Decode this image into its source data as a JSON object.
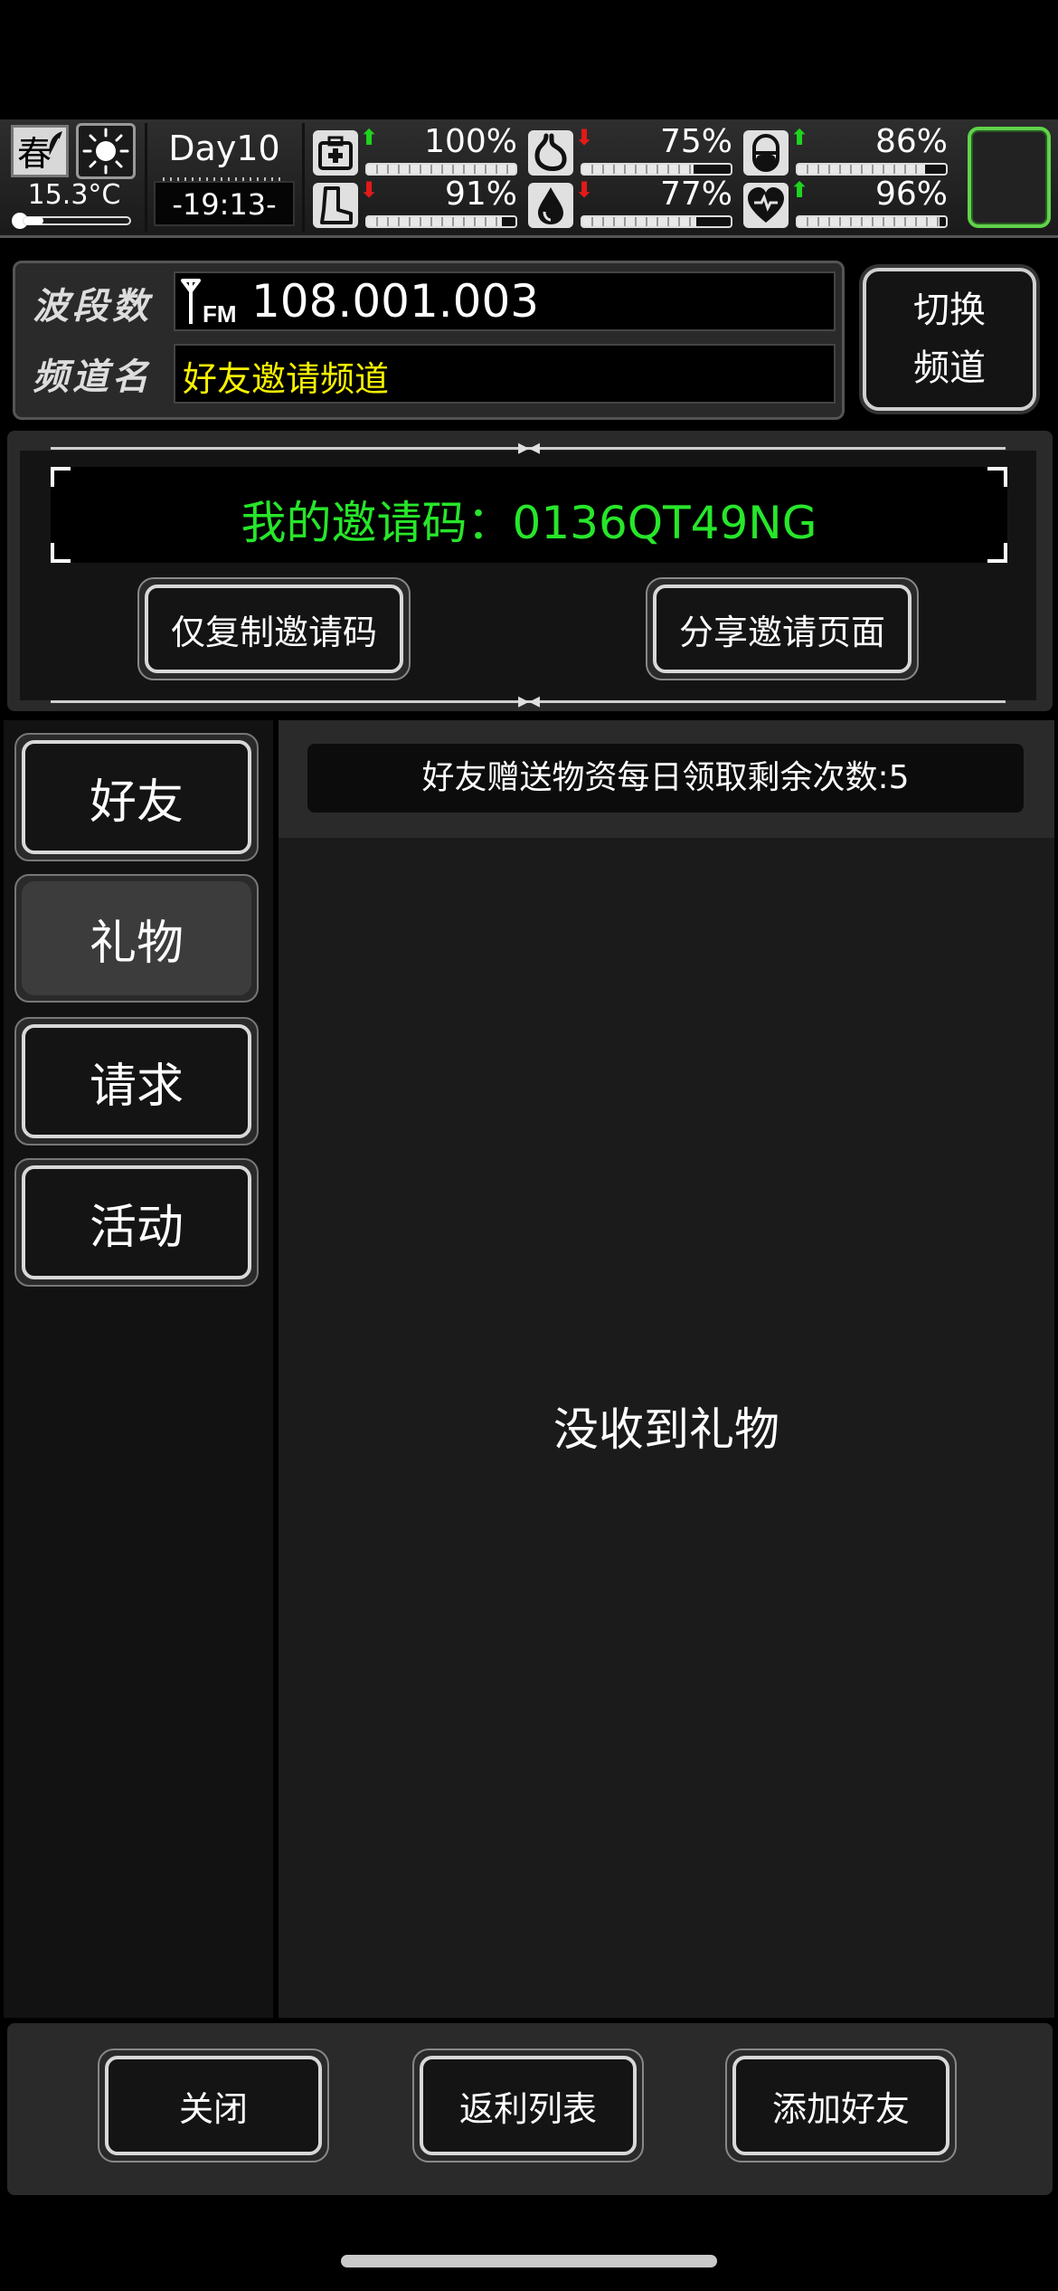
{
  "status": {
    "season": "春",
    "weather_icon": "sun-icon",
    "temperature": "15.3°C",
    "day": "Day10",
    "time": "-19:13-",
    "stats": [
      {
        "icon": "medkit-icon",
        "trend": "up",
        "value": "100%",
        "level": 1.0
      },
      {
        "icon": "stomach-icon",
        "trend": "down",
        "value": "75%",
        "level": 0.75
      },
      {
        "icon": "pill-icon",
        "trend": "up",
        "value": "86%",
        "level": 0.86
      },
      {
        "icon": "boot-icon",
        "trend": "down",
        "value": "91%",
        "level": 0.91
      },
      {
        "icon": "water-drop-icon",
        "trend": "down",
        "value": "77%",
        "level": 0.77
      },
      {
        "icon": "heart-icon",
        "trend": "up",
        "value": "96%",
        "level": 0.96
      }
    ]
  },
  "radio": {
    "band_label": "波段数",
    "frequency": "108.001.003",
    "channel_label": "频道名",
    "channel_name": "好友邀请频道",
    "switch_line1": "切换",
    "switch_line2": "频道"
  },
  "invite": {
    "code_text": "我的邀请码：0136QT49NG",
    "copy_button": "仅复制邀请码",
    "share_button": "分享邀请页面"
  },
  "tabs": [
    {
      "label": "好友",
      "active": false
    },
    {
      "label": "礼物",
      "active": true
    },
    {
      "label": "请求",
      "active": false
    },
    {
      "label": "活动",
      "active": false
    }
  ],
  "gift": {
    "daily_remaining": "好友赠送物资每日领取剩余次数:5",
    "empty_message": "没收到礼物"
  },
  "bottom": {
    "close": "关闭",
    "rebate_list": "返利列表",
    "add_friend": "添加好友"
  },
  "colors": {
    "invite_code": "#27e62a",
    "channel_name": "#f5f000",
    "up_arrow": "#1ed41e",
    "down_arrow": "#e21a1a",
    "slot_border": "#5fd34a"
  }
}
